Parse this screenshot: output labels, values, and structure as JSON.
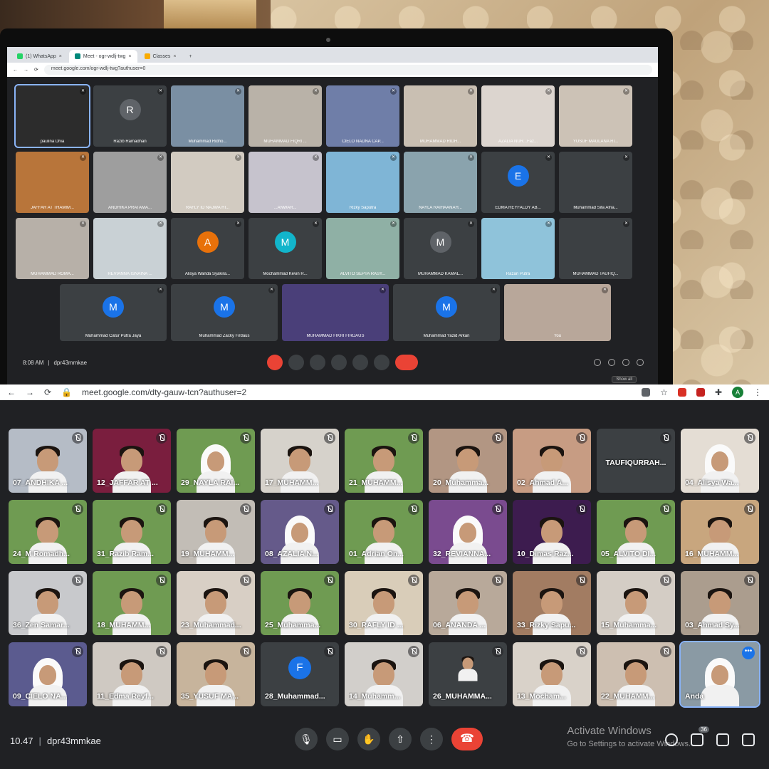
{
  "top": {
    "tabs": [
      {
        "label": "(1) WhatsApp",
        "color": "#25d366"
      },
      {
        "label": "Meet - ogr-wdlj-twg",
        "color": "#00897b"
      },
      {
        "label": "Classes",
        "color": "#f9ab00"
      }
    ],
    "url": "meet.google.com/ogr-wdlj-twg?authuser=0",
    "rows": [
      [
        {
          "name": "paulina Dhia",
          "bg": "#2c2c2c",
          "sel": true
        },
        {
          "name": "Razib Ramadhan",
          "avatar": "R",
          "avatar_color": "#5f6368"
        },
        {
          "name": "Muhammad Ridho...",
          "bg": "#7a8fa3"
        },
        {
          "name": "MUHAMMAD FIQRI ...",
          "bg": "#b9b2a8"
        },
        {
          "name": "CIELO NADNA CAP...",
          "bg": "#6f7ea8"
        },
        {
          "name": "MUHAMMAD RIDH...",
          "bg": "#c9bfb2"
        },
        {
          "name": "AZALIA NUR...Faz...",
          "bg": "#dcd5cf"
        },
        {
          "name": "YUSUF MAULANA RI...",
          "bg": "#ccc2b6"
        }
      ],
      [
        {
          "name": "JAFFAR AT THAMIM...",
          "bg": "#b8753a"
        },
        {
          "name": "ANDHIKA PRATAMA...",
          "bg": "#9e9e9e"
        },
        {
          "name": "RAFLY ID NAJWA HI...",
          "bg": "#d2cbc1"
        },
        {
          "name": "...ANWAR...",
          "bg": "#c6c3cd"
        },
        {
          "name": "Rizky Saputra",
          "bg": "#7fb5d6"
        },
        {
          "name": "NAYLA RAIHAANAH...",
          "bg": "#8aa3ad"
        },
        {
          "name": "EDMA REYFALDY AB...",
          "avatar": "E",
          "avatar_color": "#1a73e8"
        },
        {
          "name": "Muhammad Sifa Afria...",
          "bg": "#3c4043"
        }
      ],
      [
        {
          "name": "MUHAMMAD ROMA...",
          "bg": "#b7b0a8"
        },
        {
          "name": "REVIANNA ISNAINA ...",
          "bg": "#c9d1d5"
        },
        {
          "name": "Alisya Wanda Syakira...",
          "avatar": "A",
          "avatar_color": "#e8710a"
        },
        {
          "name": "Mochammad Kevin R...",
          "avatar": "M",
          "avatar_color": "#12b5cb"
        },
        {
          "name": "ALVITO SEPTA RASY...",
          "bg": "#8fb0a5"
        },
        {
          "name": "MUHAMMAD KAMAL...",
          "avatar": "M",
          "avatar_color": "#5f6368"
        },
        {
          "name": "Razan Putra",
          "bg": "#8fc3da"
        },
        {
          "name": "MUHAMMAD TAUFIQ...",
          "bg": "#3c4043"
        }
      ],
      [
        {
          "name": "Muhammad Catur Putra Jaya",
          "avatar": "M",
          "avatar_color": "#1a73e8"
        },
        {
          "name": "Muhammad Zacky Firdaus",
          "avatar": "M",
          "avatar_color": "#1a73e8"
        },
        {
          "name": "MUHAMMAD FIKRI FIRDAUS",
          "bg": "#4a3f79"
        },
        {
          "name": "Muhammad Yazid Arkan",
          "avatar": "M",
          "avatar_color": "#1a73e8"
        },
        {
          "name": "You",
          "bg": "#b8a79a"
        }
      ]
    ],
    "time": "8:08 AM",
    "meeting_code": "dpr43mmkae",
    "show_all": "Show all"
  },
  "bottom": {
    "url": "meet.google.com/dty-gauw-tcn?authuser=2",
    "profile_initial": "A",
    "rows": [
      [
        {
          "name": "07_ANDHIKA ...",
          "bg": "#b5bcc6"
        },
        {
          "name": "12_JAFFAR AT ...",
          "bg": "#7a1e3e"
        },
        {
          "name": "29_NAYLA RAI...",
          "bg": "#6f9b52",
          "hijab": true
        },
        {
          "name": "17_MUHAMM...",
          "bg": "#d6d2cb"
        },
        {
          "name": "21_MUHAMM...",
          "bg": "#6f9b52"
        },
        {
          "name": "20_Muhamma...",
          "bg": "#b29683"
        },
        {
          "name": "02_Ahmad A...",
          "bg": "#c79c83"
        },
        {
          "name": "TAUFIQURRAH...",
          "bg": "#3c4043",
          "textonly": true
        },
        {
          "name": "04_Alisya Wa...",
          "bg": "#e4ddd4",
          "hijab": true
        }
      ],
      [
        {
          "name": "24_M Romadh...",
          "bg": "#6f9b52"
        },
        {
          "name": "31_Razib Ram...",
          "bg": "#6f9b52"
        },
        {
          "name": "19_MUHAMM...",
          "bg": "#c2bdb6"
        },
        {
          "name": "08_AZALIA N...",
          "bg": "#655a8a",
          "hijab": true
        },
        {
          "name": "01_Adrian On...",
          "bg": "#6f9b52"
        },
        {
          "name": "32_REVIANNA...",
          "bg": "#7a4b8f",
          "hijab": true
        },
        {
          "name": "10_Dimas Raz...",
          "bg": "#3d1c4f"
        },
        {
          "name": "05_ALVITO DI...",
          "bg": "#6f9b52"
        },
        {
          "name": "16_MUHAMM...",
          "bg": "#c8a67e"
        }
      ],
      [
        {
          "name": "36_Zen Samar...",
          "bg": "#c8c9cc"
        },
        {
          "name": "18_MUHAMM...",
          "bg": "#6f9b52"
        },
        {
          "name": "23_Muhammad...",
          "bg": "#d8cfc5"
        },
        {
          "name": "25_Muhamma...",
          "bg": "#6f9b52"
        },
        {
          "name": "30_RAFLY ID ...",
          "bg": "#d9cdb9"
        },
        {
          "name": "06_ANANDA ...",
          "bg": "#b8a99a"
        },
        {
          "name": "33_Rizky Sapu...",
          "bg": "#a27c62"
        },
        {
          "name": "15_Muhamma...",
          "bg": "#d4cdc5"
        },
        {
          "name": "03_Ahmad Sy...",
          "bg": "#ab9d8e"
        }
      ],
      [
        {
          "name": "09_CIELO NA...",
          "bg": "#5b5b8f",
          "hijab": true
        },
        {
          "name": "11_Edma Reyf...",
          "bg": "#cfc9c2"
        },
        {
          "name": "35_YUSUF MA...",
          "bg": "#c7b49c"
        },
        {
          "name": "28_Muhammad...",
          "bg": "#3c4043",
          "avatar": "F",
          "avatar_color": "#1a73e8"
        },
        {
          "name": "14_Muhamm...",
          "bg": "#d2cfcb"
        },
        {
          "name": "26_MUHAMMA...",
          "bg": "#3c4043",
          "small_photo": true
        },
        {
          "name": "13_Mocham...",
          "bg": "#d9d2c9"
        },
        {
          "name": "22_MUHAMM...",
          "bg": "#cdbfb1"
        },
        {
          "name": "Anda",
          "bg": "#8a9aa4",
          "hijab": true,
          "self": true
        }
      ]
    ],
    "time": "10.47",
    "meeting_code": "dpr43mmkae",
    "participants_count": "36",
    "activate_title": "Activate Windows",
    "activate_sub": "Go to Settings to activate Windows."
  }
}
